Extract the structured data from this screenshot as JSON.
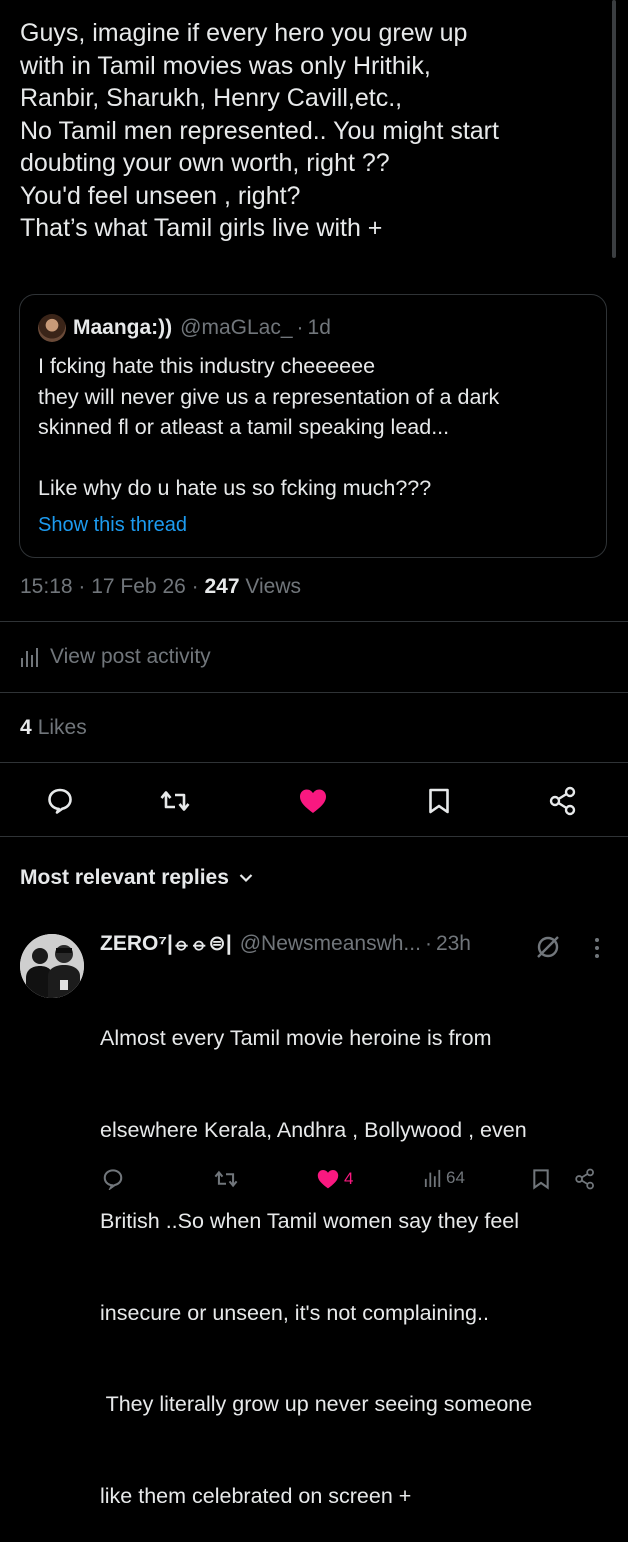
{
  "tweet": {
    "lines": [
      "Guys, imagine if every hero you grew up",
      "with in Tamil movies was only Hrithik,",
      "Ranbir, Sharukh, Henry Cavill,etc.,",
      "No Tamil men represented.. You might start",
      "doubting your own worth, right ??",
      "You'd feel unseen , right?",
      "That’s what Tamil girls live with +"
    ],
    "time": "15:18",
    "date": "17 Feb 26",
    "views_count": "247",
    "views_label": "Views",
    "activity_label": "View post activity",
    "likes_count": "4",
    "likes_label": "Likes"
  },
  "quote": {
    "name": "Maanga:))",
    "handle": "@maGLac_",
    "time": "1d",
    "lines": [
      "I fcking hate this industry cheeeeee",
      "they will never give us a representation of a dark",
      "skinned fl or atleast a tamil speaking lead...",
      "Like why do u hate us so fcking much???"
    ],
    "show_thread": "Show this thread"
  },
  "actions": {
    "icons": [
      "reply-icon",
      "repost-icon",
      "like-icon-filled",
      "bookmark-icon",
      "share-icon"
    ],
    "like_color": "#f91880"
  },
  "replies": {
    "sort_label": "Most relevant replies",
    "items": [
      {
        "name": "ZERO⁷|⦵⦵⊜|",
        "handle": "@Newsmeanswh...",
        "time": "23h",
        "lines": [
          "Almost every Tamil movie heroine is from",
          "elsewhere Kerala, Andhra , Bollywood , even",
          "British ..So when Tamil women say they feel",
          "insecure or unseen, it's not complaining..",
          " They literally grow up never seeing someone",
          "like them celebrated on screen +"
        ],
        "likes": "4",
        "views": "64"
      }
    ]
  },
  "colors": {
    "background": "#000000",
    "text": "#e7e9ea",
    "muted": "#71767b",
    "link": "#1d9bf0",
    "border": "#2f3336",
    "like": "#f91880"
  }
}
